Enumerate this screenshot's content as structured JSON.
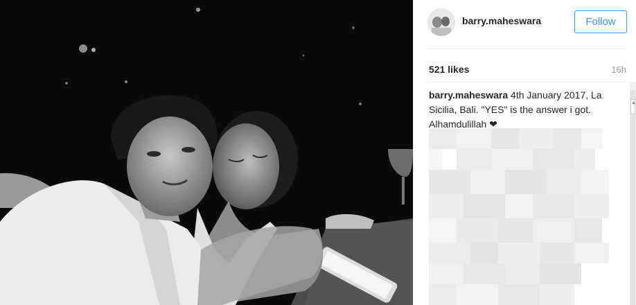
{
  "post": {
    "username": "barry.maheswara",
    "follow_label": "Follow",
    "likes": "521 likes",
    "time": "16h",
    "caption_user": "barry.maheswara",
    "caption_text": "4th January 2017, La Sicilia, Bali. \"YES\" is the answer i got. Alhamdulillah ❤"
  },
  "colors": {
    "accent": "#3897f0",
    "text": "#262626",
    "muted": "#999999"
  },
  "icons": {
    "avatar": "profile-avatar",
    "scroll": "scroll-up-arrow"
  }
}
